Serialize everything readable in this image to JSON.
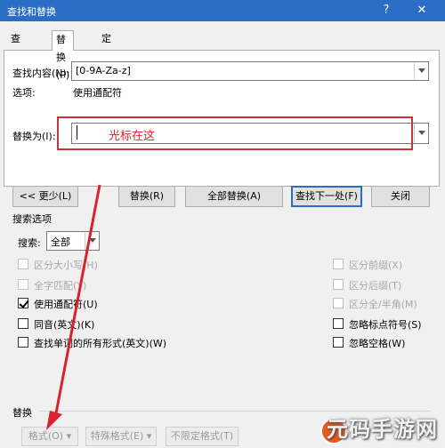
{
  "window": {
    "title": "查找和替换",
    "help_glyph": "?",
    "close_glyph": "✕"
  },
  "tabs": [
    {
      "label": "查找(D)",
      "active": false
    },
    {
      "label": "替换(P)",
      "active": true
    },
    {
      "label": "定位(G)",
      "active": false
    }
  ],
  "find": {
    "label": "查找内容(N):",
    "value": "[0-9A-Za-z]",
    "options_label": "选项:",
    "options_value": "使用通配符"
  },
  "replace": {
    "label": "替换为(I):",
    "value": "",
    "annotation": "光标在这"
  },
  "buttons": {
    "less": "<< 更少(L)",
    "replace": "替换(R)",
    "replace_all": "全部替换(A)",
    "find_next": "查找下一处(F)",
    "close": "关闭"
  },
  "search_options": {
    "heading": "搜索选项",
    "search_label": "搜索:",
    "search_value": "全部",
    "left": [
      {
        "label": "区分大小写(H)",
        "checked": false,
        "enabled": false
      },
      {
        "label": "全字匹配(Y)",
        "checked": false,
        "enabled": false
      },
      {
        "label": "使用通配符(U)",
        "checked": true,
        "enabled": true
      },
      {
        "label": "同音(英文)(K)",
        "checked": false,
        "enabled": true
      },
      {
        "label": "查找单词的所有形式(英文)(W)",
        "checked": false,
        "enabled": true
      }
    ],
    "right": [
      {
        "label": "区分前缀(X)",
        "checked": false,
        "enabled": false
      },
      {
        "label": "区分后缀(T)",
        "checked": false,
        "enabled": false
      },
      {
        "label": "区分全/半角(M)",
        "checked": false,
        "enabled": false
      },
      {
        "label": "忽略标点符号(S)",
        "checked": false,
        "enabled": true
      },
      {
        "label": "忽略空格(W)",
        "checked": false,
        "enabled": true
      }
    ]
  },
  "replace_section": {
    "heading": "替换",
    "format": "格式(O) ▾",
    "special": "特殊格式(E) ▾",
    "no_format": "不限定格式(T)"
  },
  "watermark": {
    "text": "元码手游网"
  },
  "colors": {
    "titlebar": "#2b6cc4",
    "annotation_red": "#c8343c"
  }
}
